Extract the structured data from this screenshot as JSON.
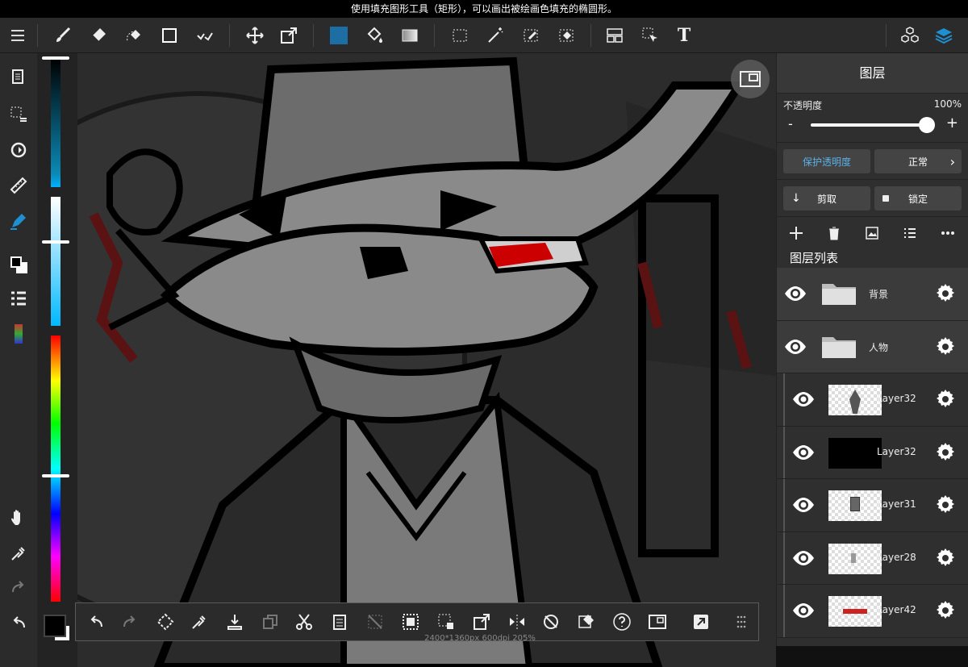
{
  "hint": "使用填充图形工具（矩形），可以画出被绘画色填充的椭圆形。",
  "toolbar": {
    "tools": [
      "menu-icon",
      "brush-icon",
      "eraser-icon",
      "lasso-eraser-icon",
      "rectangle-icon",
      "select-icon",
      "move-icon",
      "transform-icon",
      "fill-color-icon",
      "bucket-icon",
      "gradient-icon",
      "dotted-select-icon",
      "magic-wand-icon",
      "select-pen-icon",
      "select-eraser-icon",
      "frame-icon",
      "pointer-icon",
      "text-icon",
      "materials-icon",
      "layers-icon"
    ],
    "fill_color": "#1c6ea4",
    "text_label": "T"
  },
  "colors": {
    "accent": "#1e8fd0",
    "panel_bg": "#2f2f2f",
    "protect_text": "#5ab1e6"
  },
  "layers_panel": {
    "title": "图层",
    "opacity_label": "不透明度",
    "opacity_value": "100%",
    "opacity_fraction": 1.0,
    "minus": "-",
    "plus": "+",
    "protect_alpha": "保护透明度",
    "blend_mode": "正常",
    "clip": "剪取",
    "lock": "锁定",
    "list_title": "图层列表",
    "layers": [
      {
        "name": "背景",
        "type": "folder"
      },
      {
        "name": "人物",
        "type": "folder"
      },
      {
        "name": "Layer32",
        "type": "layer",
        "thumb": "figure"
      },
      {
        "name": "Layer32",
        "type": "layer",
        "thumb": "black"
      },
      {
        "name": "Layer31",
        "type": "layer",
        "thumb": "small"
      },
      {
        "name": "Layer28",
        "type": "layer",
        "thumb": "tiny"
      },
      {
        "name": "Layer42",
        "type": "layer",
        "thumb": "red"
      }
    ]
  },
  "doc_info": "2400*1360px 600dpi 205%"
}
